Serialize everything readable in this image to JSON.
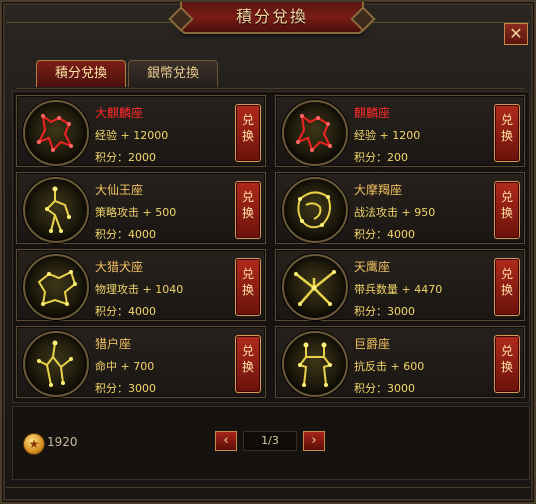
{
  "window": {
    "title": "積分兌換",
    "close_glyph": "✕"
  },
  "tabs": [
    {
      "label": "積分兌換",
      "active": true
    },
    {
      "label": "銀幣兌換",
      "active": false
    }
  ],
  "cards": [
    {
      "name": "大麒麟座",
      "name_color": "red",
      "stat": "经验 + 12000",
      "cost": "积分：2000",
      "redeem": "兑换",
      "icon": "qilin-constellation-icon"
    },
    {
      "name": "麒麟座",
      "name_color": "red",
      "stat": "经验 + 1200",
      "cost": "积分：200",
      "redeem": "兑换",
      "icon": "qilin-constellation-icon"
    },
    {
      "name": "大仙王座",
      "name_color": "gold",
      "stat": "策略攻击 + 500",
      "cost": "积分：4000",
      "redeem": "兑换",
      "icon": "cepheus-constellation-icon"
    },
    {
      "name": "大摩羯座",
      "name_color": "gold",
      "stat": "战法攻击 + 950",
      "cost": "积分：4000",
      "redeem": "兑换",
      "icon": "capricorn-constellation-icon"
    },
    {
      "name": "大猎犬座",
      "name_color": "gold",
      "stat": "物理攻击 + 1040",
      "cost": "积分：4000",
      "redeem": "兑换",
      "icon": "canes-constellation-icon"
    },
    {
      "name": "天鹰座",
      "name_color": "gold",
      "stat": "带兵数量 + 4470",
      "cost": "积分：3000",
      "redeem": "兑换",
      "icon": "aquila-constellation-icon"
    },
    {
      "name": "猎户座",
      "name_color": "gold",
      "stat": "命中 + 700",
      "cost": "积分：3000",
      "redeem": "兑换",
      "icon": "orion-constellation-icon"
    },
    {
      "name": "巨爵座",
      "name_color": "gold",
      "stat": "抗反击 + 600",
      "cost": "积分：3000",
      "redeem": "兑换",
      "icon": "crater-constellation-icon"
    }
  ],
  "footer": {
    "coin_icon": "star-coin-icon",
    "coin_count": "1920",
    "page_label": "1/3",
    "prev_glyph": "‹",
    "next_glyph": "›"
  },
  "colors": {
    "name_red": "#ff2a2a",
    "name_gold": "#f0c060",
    "stat_yellow": "#f2d66a",
    "button_red": "#b02a1c"
  }
}
